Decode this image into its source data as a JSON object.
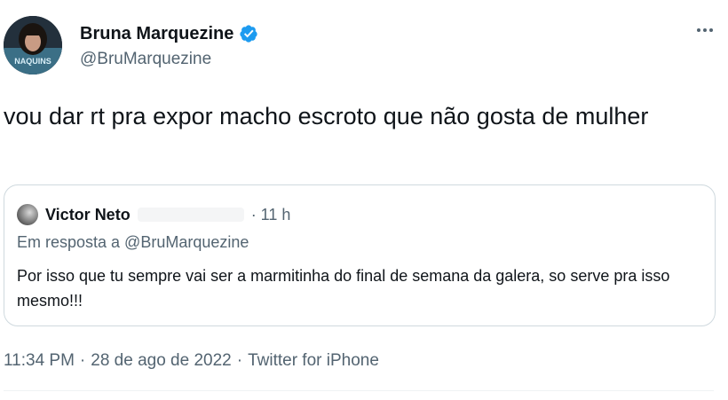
{
  "author": {
    "display_name": "Bruna Marquezine",
    "handle": "@BruMarquezine",
    "verified": true,
    "avatar_icon": "profile-photo",
    "avatar_logo_text": "NAQUINS"
  },
  "menu": {
    "icon": "more-horizontal-icon"
  },
  "tweet": {
    "text": "vou dar rt pra expor macho escroto que não gosta de mulher"
  },
  "quoted": {
    "display_name": "Victor Neto",
    "time": "· 11 h",
    "reply_context": "Em resposta a @BruMarquezine",
    "text": "Por isso que tu sempre vai ser a marmitinha do final de semana da galera, so serve pra isso mesmo!!!"
  },
  "meta": {
    "time": "11:34 PM",
    "sep1": "·",
    "date": "28 de ago de 2022",
    "sep2": "·",
    "source": "Twitter for iPhone"
  },
  "colors": {
    "verified_blue": "#1d9bf0",
    "text_primary": "#0f1419",
    "text_secondary": "#536471",
    "border": "#cfd9de"
  }
}
